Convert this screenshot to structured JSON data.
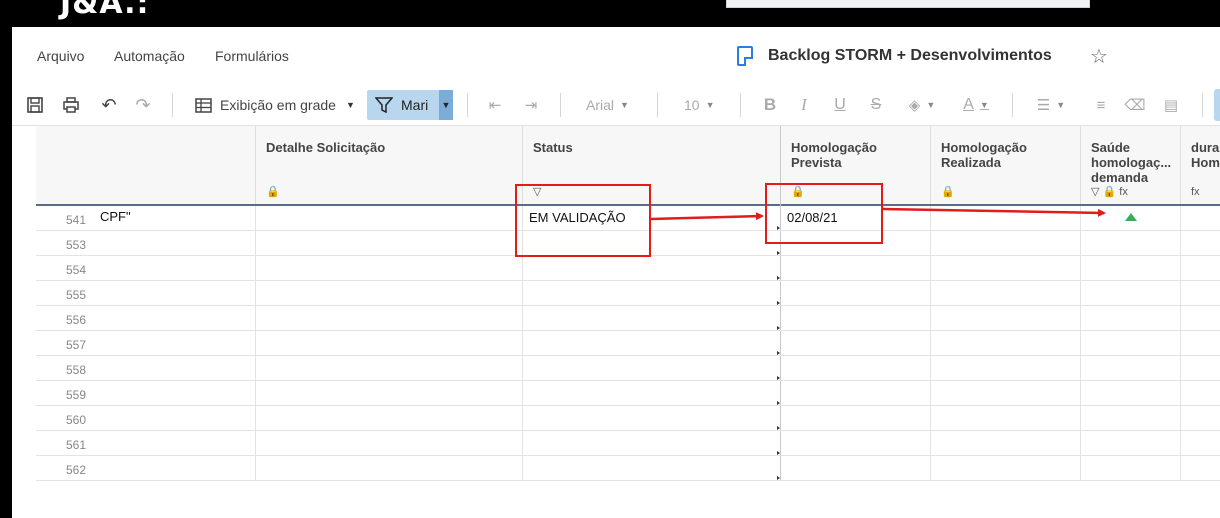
{
  "top": {
    "logo_text": "J&A.:"
  },
  "menu": {
    "items": [
      "Arquivo",
      "Automação",
      "Formulários"
    ]
  },
  "document": {
    "title": "Backlog STORM + Desenvolvimentos"
  },
  "toolbar": {
    "view_label": "Exibição em grade",
    "filter_label": "Mari",
    "font_name": "Arial",
    "font_size": "10"
  },
  "columns": [
    {
      "title": "Detalhe Solicitação",
      "icons": "🔒"
    },
    {
      "title": "Status",
      "icons": "▽"
    },
    {
      "title": "Homologação Prevista",
      "icons": "🔒"
    },
    {
      "title": "Homologação Realizada",
      "icons": "🔒"
    },
    {
      "title": "Saúde homologaç... demanda",
      "icons": "▽ 🔒 fx"
    },
    {
      "title": "dura Hom",
      "icons": "fx"
    }
  ],
  "rows": [
    {
      "num": "541",
      "first": "CPF\"",
      "status": "EM VALIDAÇÃO",
      "prevista": "02/08/21",
      "saude": "up"
    },
    {
      "num": "553"
    },
    {
      "num": "554"
    },
    {
      "num": "555"
    },
    {
      "num": "556"
    },
    {
      "num": "557"
    },
    {
      "num": "558"
    },
    {
      "num": "559"
    },
    {
      "num": "560"
    },
    {
      "num": "561"
    },
    {
      "num": "562"
    }
  ],
  "colors": {
    "accent": "#2a7de1",
    "filter_bg": "#b9d6ef",
    "annotation": "#e21b1b",
    "health_up": "#3daa5a"
  }
}
